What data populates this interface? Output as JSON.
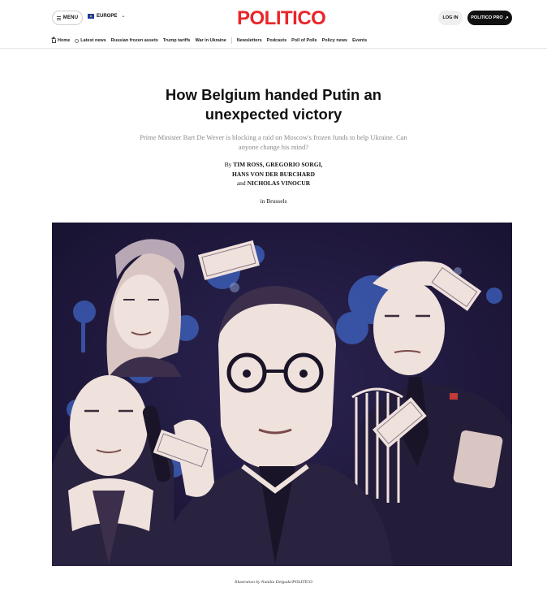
{
  "header": {
    "menu_label": "MENU",
    "edition_label": "EUROPE",
    "logo": "POLITICO",
    "login_label": "LOG IN",
    "pro_label": "POLITICO PRO"
  },
  "nav": {
    "items": [
      "Home",
      "Latest news",
      "Russian frozen assets",
      "Trump tariffs",
      "War in Ukraine",
      "Newsletters",
      "Podcasts",
      "Poll of Polls",
      "Policy news",
      "Events"
    ]
  },
  "article": {
    "headline": "How Belgium handed Putin an unexpected victory",
    "dek": "Prime Minister Bart De Wever is blocking a raid on Moscow's frozen funds to help Ukraine. Can anyone change his mind?",
    "by": "By",
    "authors_line1": "TIM ROSS, GREGORIO SORGI,",
    "authors_line2": "HANS VON DER BURCHARD",
    "and": "and",
    "authors_line3": "NICHOLAS VINOCUR",
    "dateline": "in Brussels",
    "caption": "Illustration by Natália Delgado/POLITICO"
  },
  "colors": {
    "brand_red": "#e8262a",
    "illustration_bg": "#1d1736",
    "illustration_blue": "#3f64c4",
    "skin": "#efe1dc"
  }
}
